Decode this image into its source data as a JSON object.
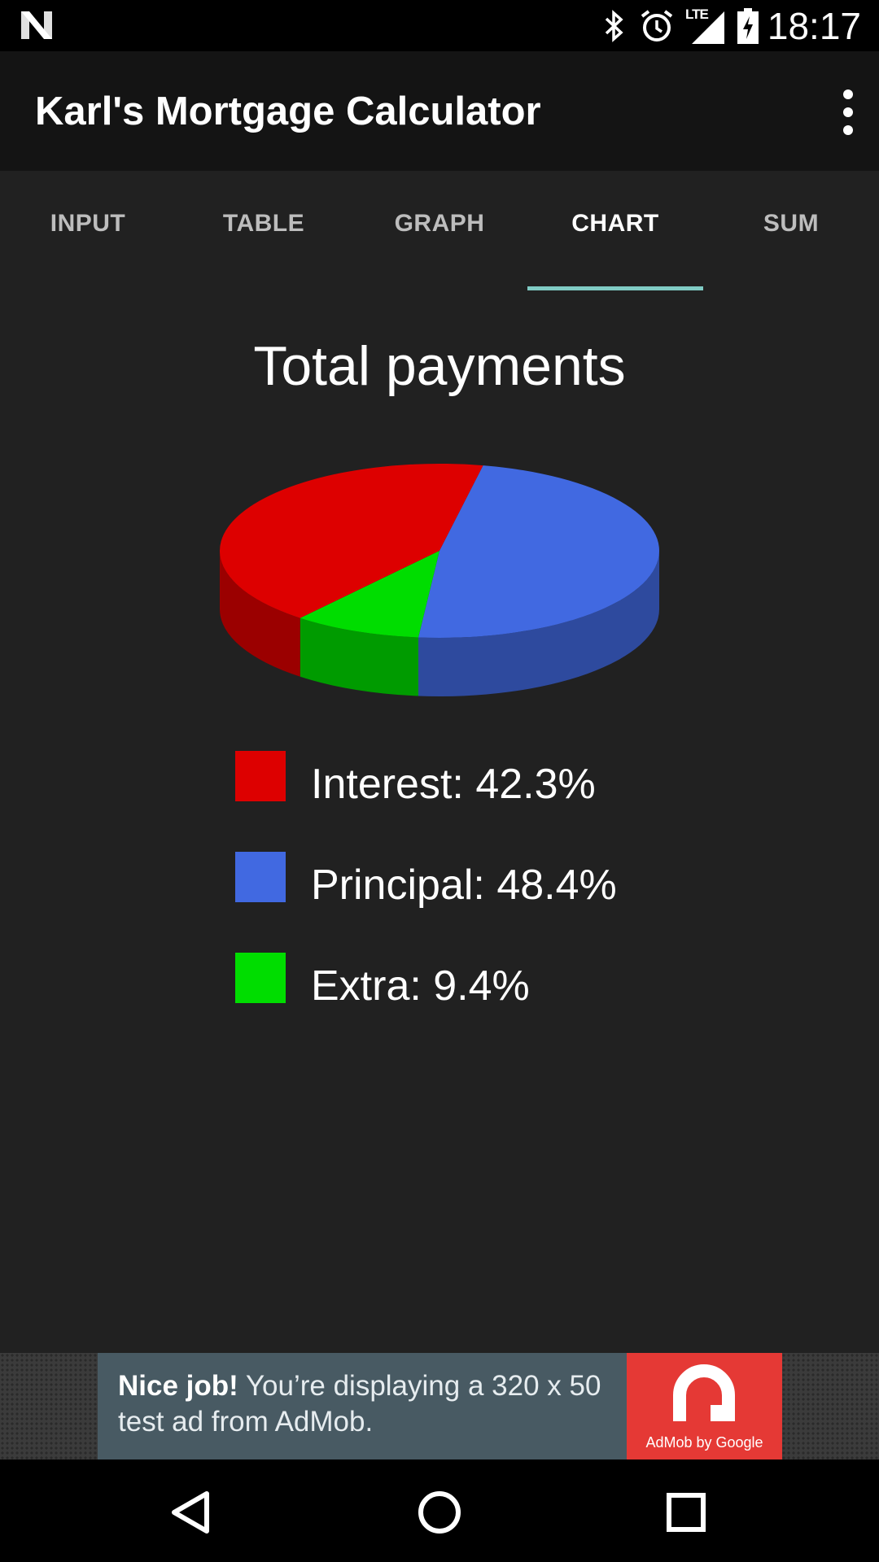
{
  "status_bar": {
    "time": "18:17",
    "network_label": "LTE",
    "icons": [
      "n-logo-icon",
      "bluetooth-icon",
      "alarm-icon",
      "lte-signal-icon",
      "battery-charging-icon"
    ]
  },
  "app_bar": {
    "title": "Karl's Mortgage Calculator",
    "overflow_icon": "more-vert-icon"
  },
  "tabs": [
    {
      "label": "INPUT",
      "active": false
    },
    {
      "label": "TABLE",
      "active": false
    },
    {
      "label": "GRAPH",
      "active": false
    },
    {
      "label": "CHART",
      "active": true
    },
    {
      "label": "SUM",
      "active": false
    }
  ],
  "colors": {
    "interest": "#dd0000",
    "principal": "#4169e1",
    "extra": "#00dd00",
    "tab_indicator": "#80cbc4",
    "background": "#212121"
  },
  "chart_data": {
    "type": "pie",
    "style": "3d",
    "title": "Total payments",
    "categories": [
      "Interest",
      "Principal",
      "Extra"
    ],
    "values": [
      42.3,
      48.4,
      9.4
    ],
    "unit": "%",
    "legend": [
      "Interest: 42.3%",
      "Principal: 48.4%",
      "Extra: 9.4%"
    ],
    "legend_placement": "bottom"
  },
  "ad": {
    "headline": "Nice job!",
    "body": " You’re displaying a 320 x 50 test ad from AdMob.",
    "logo_caption": "AdMob by Google"
  },
  "nav_bar": {
    "buttons": [
      "back-icon",
      "home-icon",
      "recents-icon"
    ]
  }
}
